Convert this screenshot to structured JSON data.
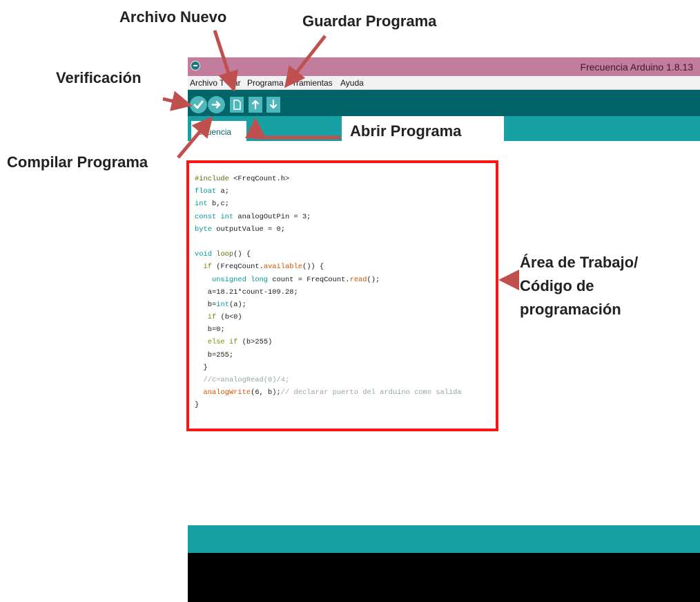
{
  "window": {
    "title": "Frecuencia Arduino 1.8.13"
  },
  "menu": {
    "items": [
      "Archivo",
      "Editar",
      "Programa",
      "Herramientas",
      "Ayuda"
    ],
    "visible_text": [
      "Archivo",
      "T",
      "ar",
      "Programa",
      "rramientas",
      "Ayuda"
    ]
  },
  "toolbar": {
    "buttons": [
      {
        "name": "verify",
        "icon": "check-icon"
      },
      {
        "name": "upload",
        "icon": "arrow-right-icon"
      },
      {
        "name": "new",
        "icon": "new-file-icon"
      },
      {
        "name": "open",
        "icon": "arrow-up-icon"
      },
      {
        "name": "save",
        "icon": "arrow-down-icon"
      }
    ]
  },
  "tab": {
    "label": "ecuencia"
  },
  "code": {
    "lines": [
      "#include <FreqCount.h>",
      "float a;",
      "int b,c;",
      "const int analogOutPin = 3;",
      "byte outputValue = 0;",
      "",
      "void loop() {",
      "  if (FreqCount.available()) {",
      "    unsigned long count = FreqCount.read();",
      "   a=18.21*count-109.28;",
      "   b=int(a);",
      "   if (b<0)",
      "   b=0;",
      "   else if (b>255)",
      "   b=255;",
      "  }",
      "  //c=analogRead(0)/4;",
      "  analogWrite(6, b);// declarar puerto del arduino como salida",
      "}"
    ]
  },
  "annotations": {
    "archivo_nuevo": "Archivo Nuevo",
    "guardar_programa": "Guardar Programa",
    "verificacion": "Verificación",
    "abrir_programa": "Abrir Programa",
    "compilar_programa": "Compilar Programa",
    "area_trabajo": [
      "Área de Trabajo/",
      "Código de",
      "programación"
    ]
  },
  "colors": {
    "titlebar": "#c47c9c",
    "toolbar": "#006468",
    "tabs": "#17a1a5",
    "button": "#4db7bb",
    "arrow": "#c0504d",
    "highlight_box": "#ff1414",
    "console": "#000000"
  }
}
